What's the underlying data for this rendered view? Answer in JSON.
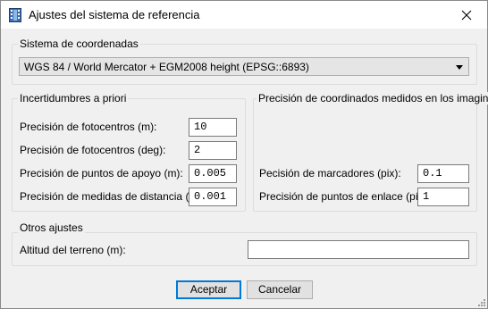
{
  "dialog": {
    "title": "Ajustes del sistema de referencia"
  },
  "coord_system": {
    "group_label": "Sistema de coordenadas",
    "selected": "WGS 84 / World Mercator + EGM2008 height (EPSG::6893)"
  },
  "apriori": {
    "group_label": "Incertidumbres a priori",
    "rows": [
      {
        "label": "Precisión de fotocentros (m):",
        "value": "10"
      },
      {
        "label": "Precisión de fotocentros (deg):",
        "value": "2"
      },
      {
        "label": "Precisión de puntos de apoyo (m):",
        "value": "0.005"
      },
      {
        "label": "Precisión de medidas de distancia (m):",
        "value": "0.001"
      }
    ]
  },
  "measured": {
    "group_label": "Precisión de coordinados medidos en los imagines",
    "rows": [
      {
        "label": "Pecisión de marcadores (pix):",
        "value": "0.1"
      },
      {
        "label": "Precisión de puntos de enlace (píx):",
        "value": "1"
      }
    ]
  },
  "other": {
    "group_label": "Otros ajustes",
    "terrain_label": "Altitud del terreno (m):",
    "terrain_value": ""
  },
  "buttons": {
    "accept": "Aceptar",
    "cancel": "Cancelar"
  }
}
